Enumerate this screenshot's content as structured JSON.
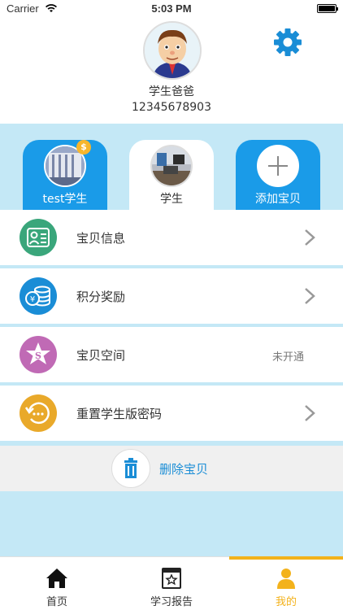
{
  "status_bar": {
    "carrier": "Carrier",
    "time": "5:03 PM"
  },
  "profile": {
    "name": "学生爸爸",
    "phone": "12345678903"
  },
  "child_tabs": [
    {
      "label": "test学生",
      "badge": "$",
      "selected": false
    },
    {
      "label": "学生",
      "selected": true
    },
    {
      "label": "添加宝贝",
      "icon": "plus-icon",
      "selected": false
    }
  ],
  "menu": [
    {
      "label": "宝贝信息",
      "icon": "profile-card-icon",
      "color": "#3aa67b"
    },
    {
      "label": "积分奖励",
      "icon": "coin-stack-icon",
      "color": "#1a8dd6"
    },
    {
      "label": "宝贝空间",
      "icon": "star-s-icon",
      "color": "#c06ab5",
      "status": "未开通"
    },
    {
      "label": "重置学生版密码",
      "icon": "password-reset-icon",
      "color": "#e9a92a"
    }
  ],
  "delete": {
    "label": "删除宝贝"
  },
  "bottom_nav": [
    {
      "label": "首页",
      "icon": "home-icon"
    },
    {
      "label": "学习报告",
      "icon": "report-icon"
    },
    {
      "label": "我的",
      "icon": "person-icon",
      "active": true
    }
  ],
  "colors": {
    "accent": "#1a9be8",
    "nav_active": "#f3b21b",
    "background": "#c4e8f6"
  }
}
